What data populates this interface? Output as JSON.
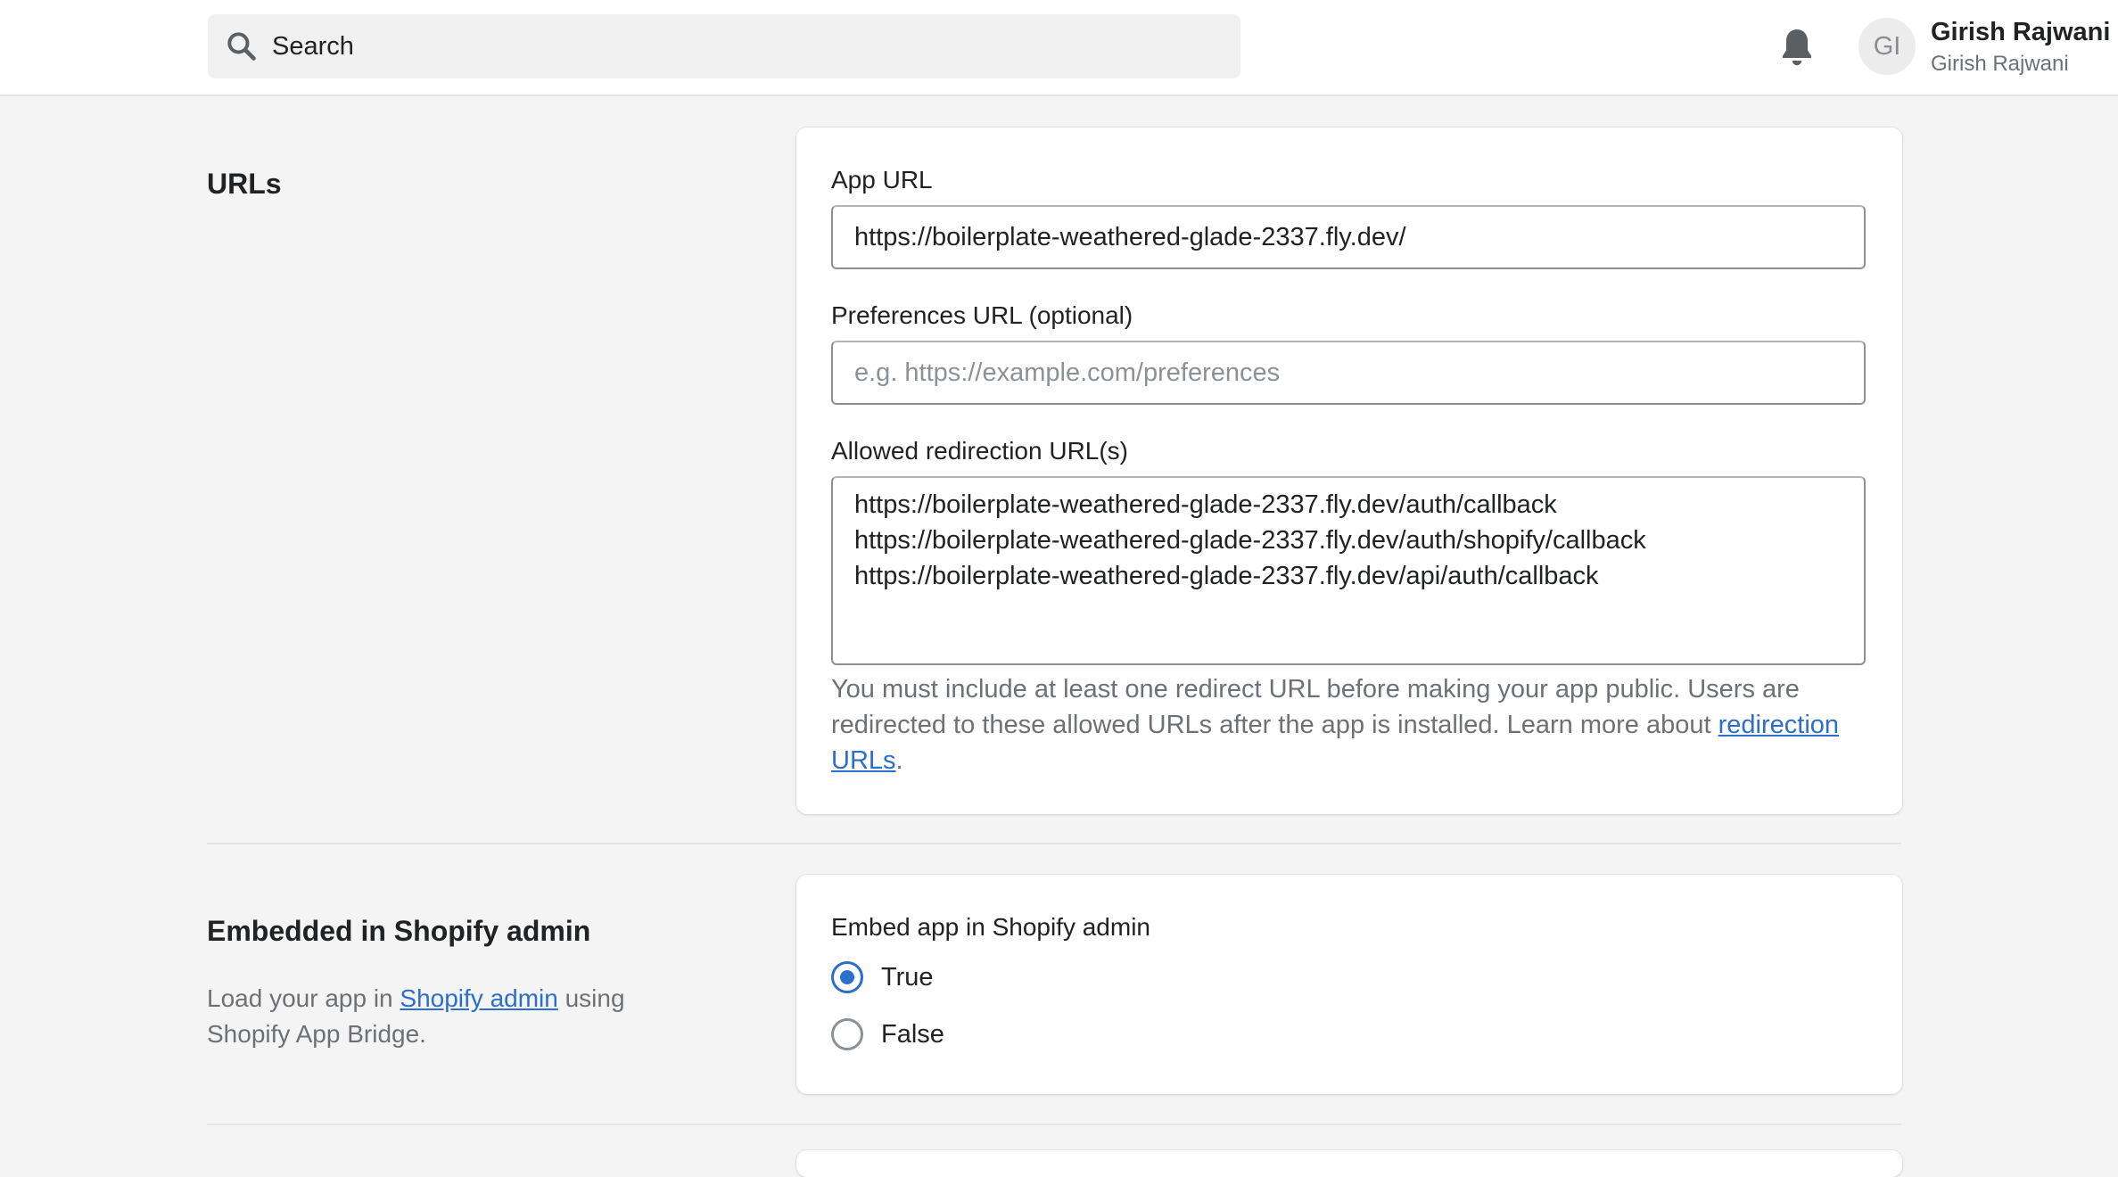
{
  "topbar": {
    "search_placeholder": "Search",
    "avatar_initials": "GI",
    "user_name": "Girish Rajwani",
    "user_store": "Girish Rajwani"
  },
  "urls_section": {
    "title": "URLs",
    "app_url": {
      "label": "App URL",
      "value": "https://boilerplate-weathered-glade-2337.fly.dev/"
    },
    "preferences_url": {
      "label": "Preferences URL (optional)",
      "value": "",
      "placeholder": "e.g. https://example.com/preferences"
    },
    "redirection_urls": {
      "label": "Allowed redirection URL(s)",
      "lines": [
        "https://boilerplate-weathered-glade-2337.fly.dev/auth/callback",
        "https://boilerplate-weathered-glade-2337.fly.dev/auth/shopify/callback",
        "https://boilerplate-weathered-glade-2337.fly.dev/api/auth/callback"
      ]
    },
    "help_text_before": "You must include at least one redirect URL before making your app public. Users are redirected to these allowed URLs after the app is installed. Learn more about ",
    "help_link": "redirection URLs",
    "help_text_after": "."
  },
  "embedded_section": {
    "title": "Embedded in Shopify admin",
    "desc_before": "Load your app in ",
    "desc_link": "Shopify admin",
    "desc_after": " using Shopify App Bridge.",
    "field_label": "Embed app in Shopify admin",
    "options": [
      {
        "label": "True",
        "checked": true
      },
      {
        "label": "False",
        "checked": false
      }
    ]
  },
  "colors": {
    "accent": "#2c6ecb",
    "background": "#f4f4f4",
    "card": "#ffffff"
  },
  "icons": [
    "search-icon",
    "bell-icon"
  ]
}
